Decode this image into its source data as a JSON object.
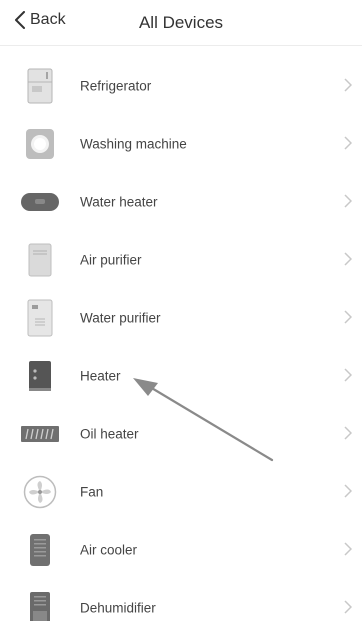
{
  "header": {
    "back_label": "Back",
    "title": "All Devices"
  },
  "devices": [
    {
      "label": "Refrigerator",
      "icon": "refrigerator-icon"
    },
    {
      "label": "Washing machine",
      "icon": "washing-machine-icon"
    },
    {
      "label": "Water heater",
      "icon": "water-heater-icon"
    },
    {
      "label": "Air purifier",
      "icon": "air-purifier-icon"
    },
    {
      "label": "Water purifier",
      "icon": "water-purifier-icon"
    },
    {
      "label": "Heater",
      "icon": "heater-icon"
    },
    {
      "label": "Oil heater",
      "icon": "oil-heater-icon"
    },
    {
      "label": "Fan",
      "icon": "fan-icon"
    },
    {
      "label": "Air cooler",
      "icon": "air-cooler-icon"
    },
    {
      "label": "Dehumidifier",
      "icon": "dehumidifier-icon"
    }
  ],
  "colors": {
    "text": "#444444",
    "chevron": "#c8c8c8",
    "icon_fill": "#9a9a9a",
    "annotation_arrow": "#8a8a8a"
  }
}
